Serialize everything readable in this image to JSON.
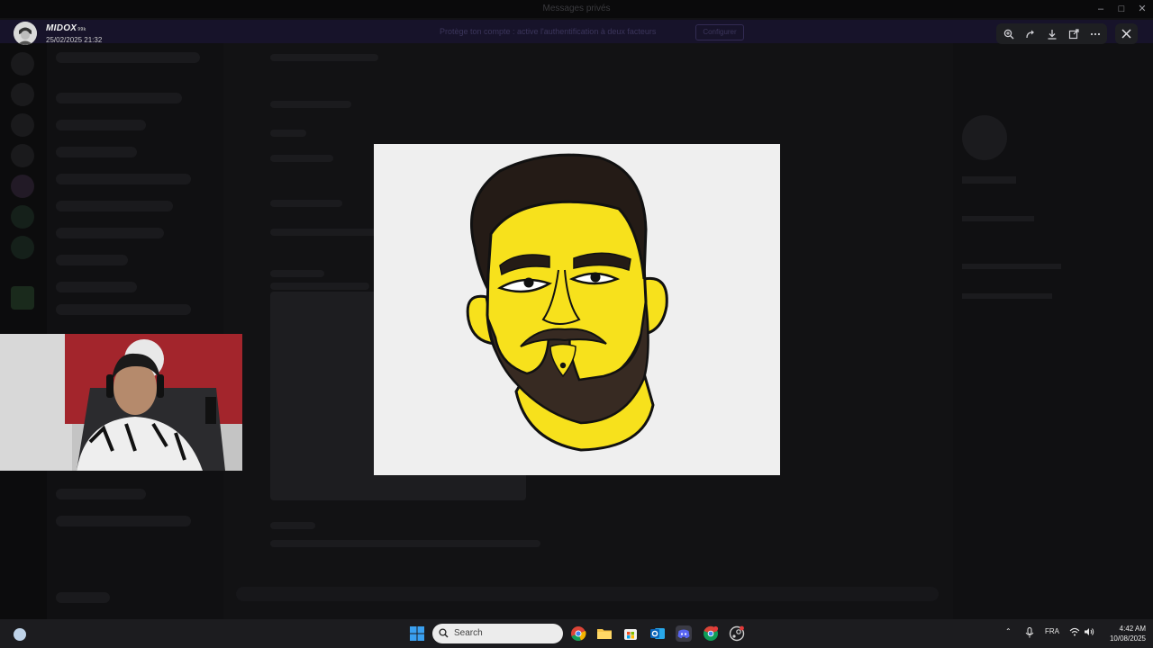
{
  "window": {
    "title": "Messages privés"
  },
  "banner": {
    "text": "Protège ton compte : active l'authentification à deux facteurs",
    "button": "Configurer"
  },
  "viewer": {
    "username": "MIDOX",
    "username_tag": "99k",
    "date": "25/02/2025 21:32",
    "toolbar": [
      {
        "icon": "zoom-in-icon"
      },
      {
        "icon": "rotate-icon"
      },
      {
        "icon": "download-icon"
      },
      {
        "icon": "open-external-icon"
      },
      {
        "icon": "more-icon"
      }
    ],
    "close_icon": "close-icon"
  },
  "image": {
    "subject": "cartoon-portrait",
    "background": "#efefef",
    "skin_color": "#f7e11c",
    "hair_color": "#241b16",
    "beard_color": "#372a22"
  },
  "taskbar": {
    "search_placeholder": "Search",
    "language": "FRA",
    "time": "4:42 AM",
    "date": "10/08/2025",
    "apps": [
      "start-icon",
      "chrome-icon",
      "file-explorer-icon",
      "store-icon",
      "outlook-icon",
      "discord-icon",
      "chrome-profile-icon",
      "steam-icon"
    ]
  }
}
